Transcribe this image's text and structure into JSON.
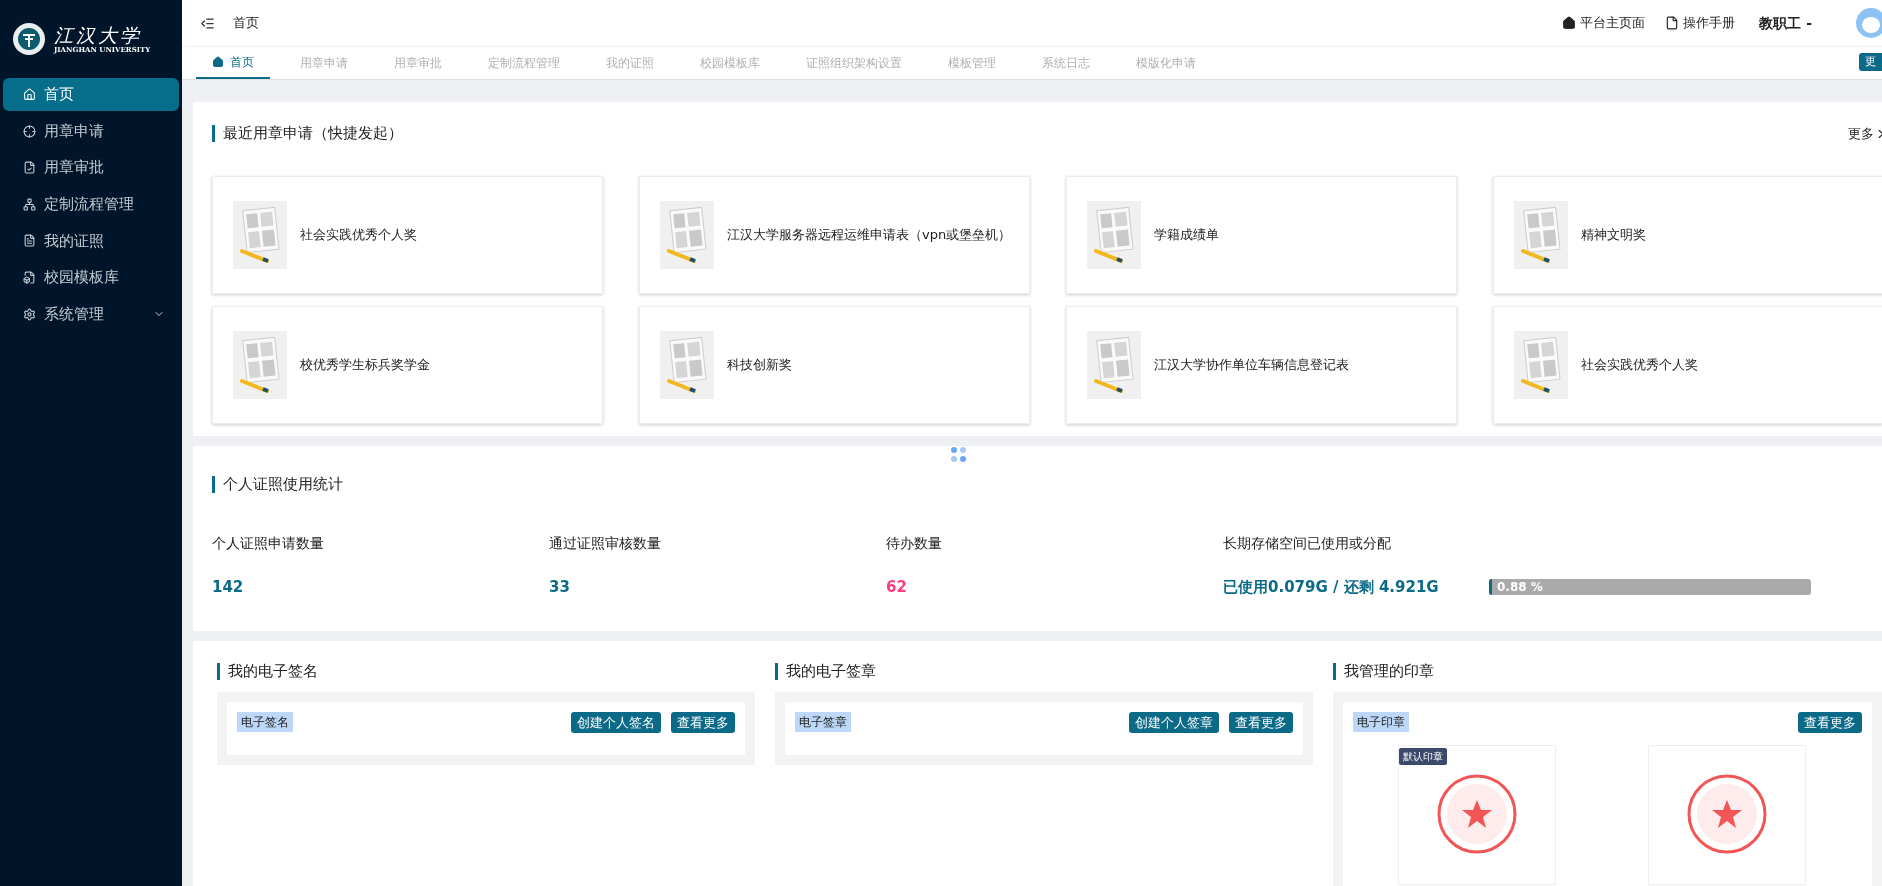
{
  "logo": {
    "name": "江汉大学",
    "subtitle": "JIANGHAN UNIVERSITY"
  },
  "sidebar": {
    "items": [
      {
        "label": "首页",
        "selected": true,
        "expandable": false
      },
      {
        "label": "用章申请",
        "selected": false,
        "expandable": false
      },
      {
        "label": "用章审批",
        "selected": false,
        "expandable": false
      },
      {
        "label": "定制流程管理",
        "selected": false,
        "expandable": false
      },
      {
        "label": "我的证照",
        "selected": false,
        "expandable": false
      },
      {
        "label": "校园模板库",
        "selected": false,
        "expandable": false
      },
      {
        "label": "系统管理",
        "selected": false,
        "expandable": true
      }
    ]
  },
  "header": {
    "breadcrumb": "首页",
    "links": [
      {
        "label": "平台主页面"
      },
      {
        "label": "操作手册"
      }
    ],
    "user": "教职工 -"
  },
  "tabs": [
    {
      "label": "首页",
      "selected": true
    },
    {
      "label": "用章申请",
      "selected": false
    },
    {
      "label": "用章审批",
      "selected": false
    },
    {
      "label": "定制流程管理",
      "selected": false
    },
    {
      "label": "我的证照",
      "selected": false
    },
    {
      "label": "校园模板库",
      "selected": false
    },
    {
      "label": "证照组织架构设置",
      "selected": false
    },
    {
      "label": "模板管理",
      "selected": false
    },
    {
      "label": "系统日志",
      "selected": false
    },
    {
      "label": "模版化申请",
      "selected": false
    }
  ],
  "tabs_more": "更",
  "recent": {
    "title": "最近用章申请（快捷发起）",
    "more": "更多",
    "items": [
      {
        "label": "社会实践优秀个人奖"
      },
      {
        "label": "江汉大学服务器远程运维申请表（vpn或堡垒机）"
      },
      {
        "label": "学籍成绩单"
      },
      {
        "label": "精神文明奖"
      },
      {
        "label": "校优秀学生标兵奖学金"
      },
      {
        "label": "科技创新奖"
      },
      {
        "label": "江汉大学协作单位车辆信息登记表"
      },
      {
        "label": "社会实践优秀个人奖"
      }
    ]
  },
  "stats": {
    "title": "个人证照使用统计",
    "items": [
      {
        "label": "个人证照申请数量",
        "value": "142",
        "color": "#0b6a87"
      },
      {
        "label": "通过证照审核数量",
        "value": "33",
        "color": "#0b6a87"
      },
      {
        "label": "待办数量",
        "value": "62",
        "color": "#ff3d7f"
      }
    ],
    "storage": {
      "label": "长期存储空间已使用或分配",
      "used": "已使用0.079G / 还剩 4.921G",
      "level": 0.0088,
      "reading": "0.88 %"
    }
  },
  "panels": [
    {
      "title": "我的电子签名",
      "tag": "电子签名",
      "buttons": [
        "创建个人签名",
        "查看更多"
      ]
    },
    {
      "title": "我的电子签章",
      "tag": "电子签章",
      "buttons": [
        "创建个人签章",
        "查看更多"
      ]
    }
  ],
  "seals": {
    "title": "我管理的印章",
    "tag": "电子印章",
    "buttons": [
      "查看更多"
    ],
    "badge": "默认印章",
    "items": [
      {
        "default": true
      },
      {
        "default": false
      }
    ]
  }
}
